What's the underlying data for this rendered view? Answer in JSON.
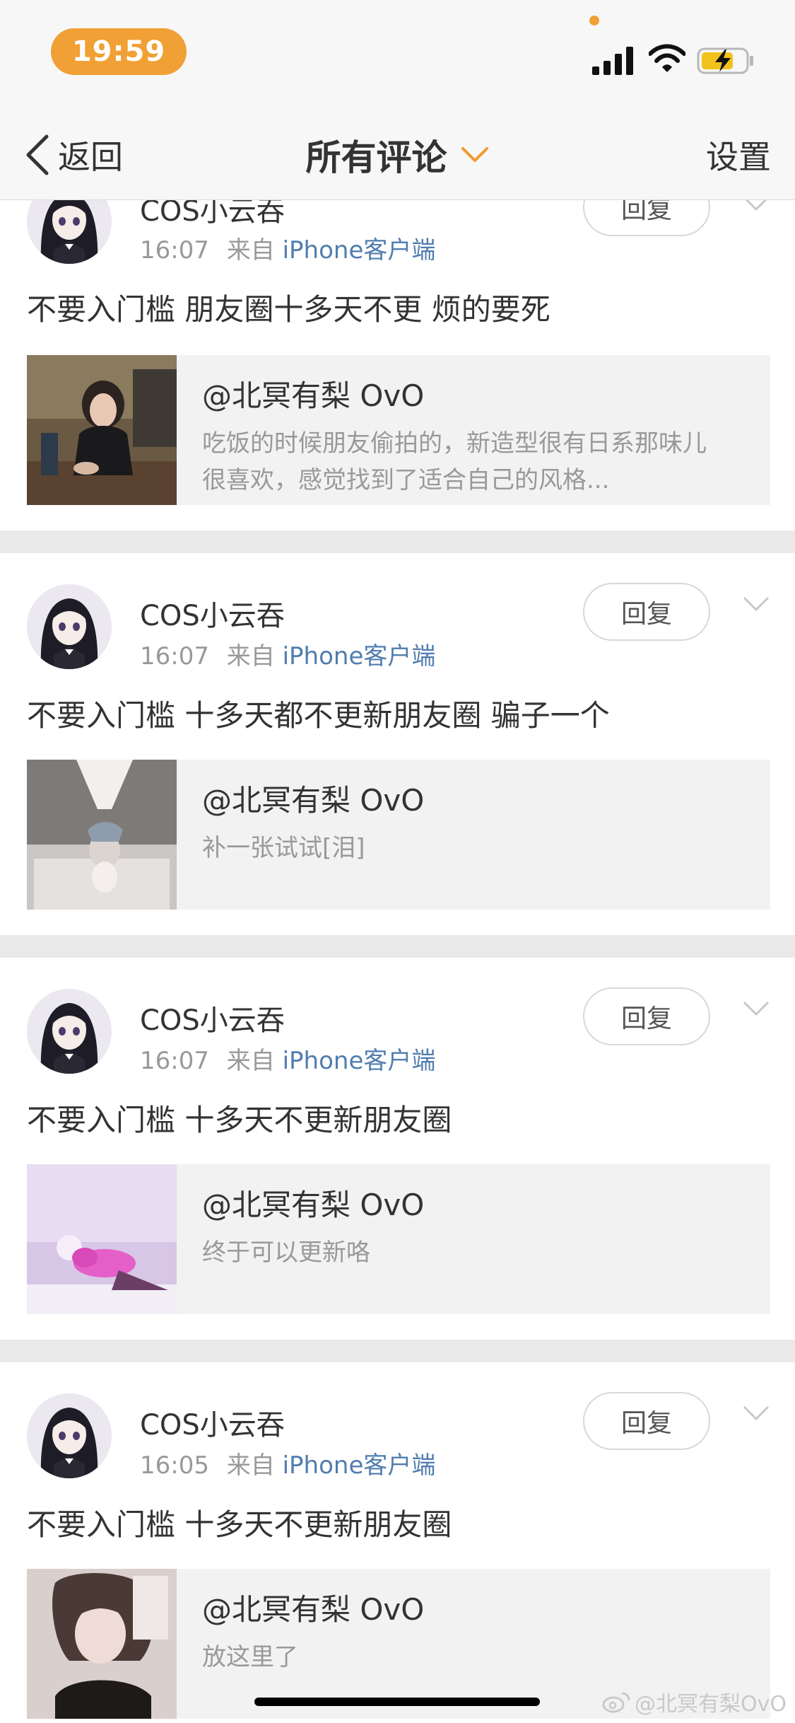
{
  "status_bar": {
    "time": "19:59",
    "accent_color": "#f0a035"
  },
  "nav": {
    "back_label": "返回",
    "title": "所有评论",
    "settings_label": "设置"
  },
  "comments": [
    {
      "username": "COS小云吞",
      "time": "16:07",
      "from_label": "来自",
      "source": "iPhone客户端",
      "reply_label": "回复",
      "text": "不要入门槛 朋友圈十多天不更 烦的要死",
      "quote": {
        "author": "@北冥有梨 OvO",
        "text_line1": "吃饭的时候朋友偷拍的，新造型很有日系那味儿",
        "text_line2": "很喜欢，感觉找到了适合自己的风格..."
      }
    },
    {
      "username": "COS小云吞",
      "time": "16:07",
      "from_label": "来自",
      "source": "iPhone客户端",
      "reply_label": "回复",
      "text": "不要入门槛 十多天都不更新朋友圈 骗子一个",
      "quote": {
        "author": "@北冥有梨 OvO",
        "text_line1": "补一张试试[泪]",
        "text_line2": ""
      }
    },
    {
      "username": "COS小云吞",
      "time": "16:07",
      "from_label": "来自",
      "source": "iPhone客户端",
      "reply_label": "回复",
      "text": "不要入门槛 十多天不更新朋友圈",
      "quote": {
        "author": "@北冥有梨 OvO",
        "text_line1": "终于可以更新咯",
        "text_line2": ""
      }
    },
    {
      "username": "COS小云吞",
      "time": "16:05",
      "from_label": "来自",
      "source": "iPhone客户端",
      "reply_label": "回复",
      "text": "不要入门槛 十多天不更新朋友圈",
      "quote": {
        "author": "@北冥有梨 OvO",
        "text_line1": "放这里了",
        "text_line2": ""
      }
    }
  ],
  "watermark": "@北冥有梨OvO"
}
